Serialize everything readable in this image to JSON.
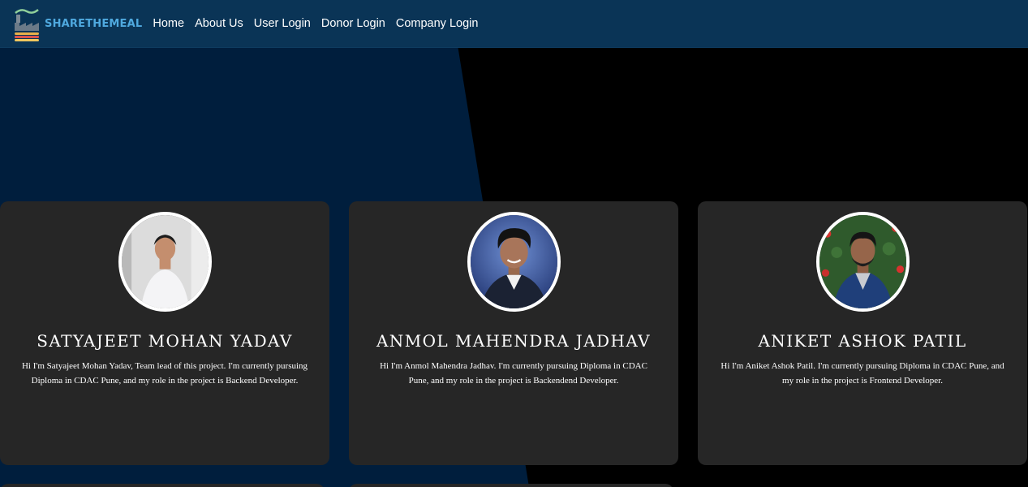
{
  "brand": {
    "name": "SHARETHEMEAL"
  },
  "nav": {
    "links": [
      {
        "label": "Home"
      },
      {
        "label": "About Us"
      },
      {
        "label": "User Login"
      },
      {
        "label": "Donor Login"
      },
      {
        "label": "Company Login"
      }
    ]
  },
  "team": [
    {
      "name": "SATYAJEET MOHAN YADAV",
      "description": "Hi I'm Satyajeet Mohan Yadav, Team lead of this project. I'm currently pursuing Diploma in CDAC Pune, and my role in the project is Backend Developer."
    },
    {
      "name": "ANMOL MAHENDRA JADHAV",
      "description": "Hi I'm Anmol Mahendra Jadhav. I'm currently pursuing Diploma in CDAC Pune, and my role in the project is Backendend Developer."
    },
    {
      "name": "ANIKET ASHOK PATIL",
      "description": "Hi I'm Aniket Ashok Patil. I'm currently pursuing Diploma in CDAC Pune, and my role in the project is Frontend Developer."
    }
  ],
  "colors": {
    "navbar": "#0a3456",
    "hero_left": "#001e3d",
    "hero_right": "#000000",
    "card": "#262626",
    "brand_text": "#4fa9df"
  },
  "icons": {
    "logo": "burger-factory-logo-icon"
  }
}
